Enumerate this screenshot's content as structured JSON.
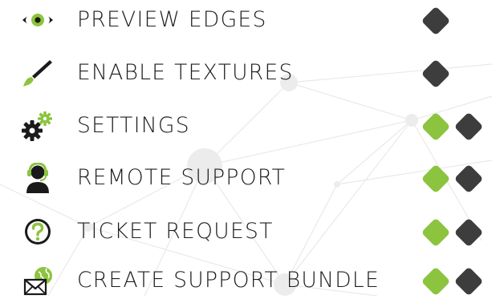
{
  "theme": {
    "accent_green": "#8cc43f",
    "dark_marker": "#3d3d3d",
    "icon_dark": "#1a1a1a",
    "text": "#1e1e1e"
  },
  "menu": {
    "items": [
      {
        "label": "PREVIEW EDGES",
        "icon": "eye-icon",
        "status": [
          "dark"
        ]
      },
      {
        "label": "ENABLE TEXTURES",
        "icon": "paintbrush-icon",
        "status": [
          "dark"
        ]
      },
      {
        "label": "SETTINGS",
        "icon": "gears-icon",
        "status": [
          "green",
          "dark"
        ]
      },
      {
        "label": "REMOTE SUPPORT",
        "icon": "headset-agent-icon",
        "status": [
          "green",
          "dark"
        ]
      },
      {
        "label": "TICKET REQUEST",
        "icon": "question-circle-icon",
        "status": [
          "green",
          "dark"
        ]
      },
      {
        "label": "CREATE SUPPORT BUNDLE",
        "icon": "globe-envelope-icon",
        "status": [
          "green",
          "dark"
        ]
      }
    ]
  }
}
